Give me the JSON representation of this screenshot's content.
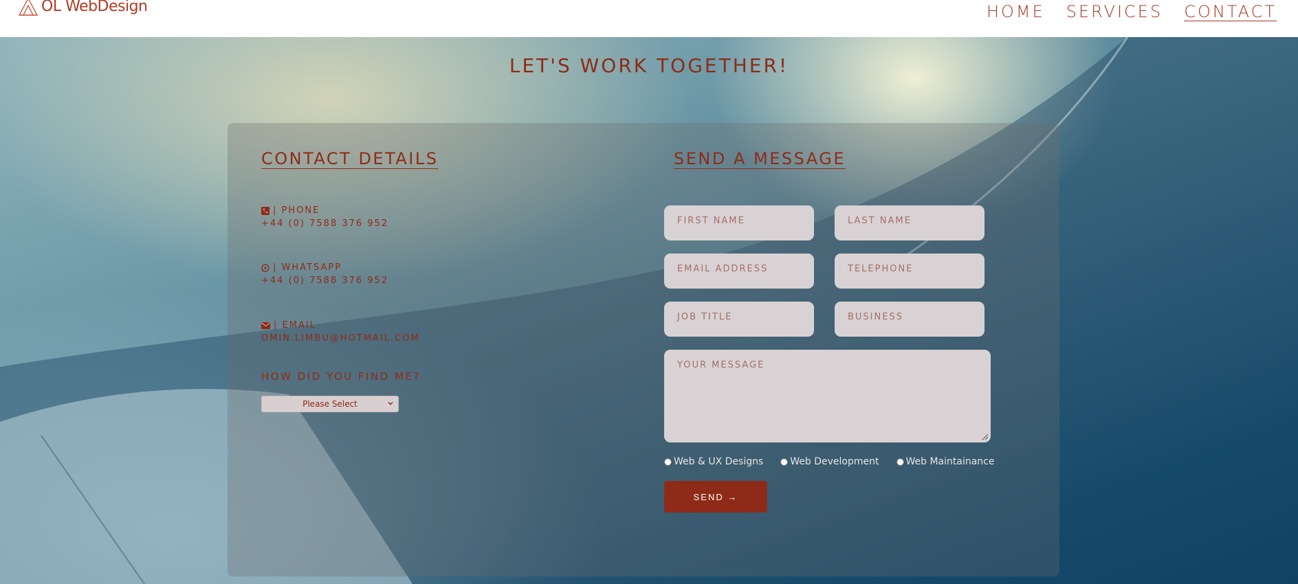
{
  "brand": {
    "name": "OL WebDesign"
  },
  "nav": {
    "items": [
      {
        "label": "HOME"
      },
      {
        "label": "SERVICES"
      },
      {
        "label": "CONTACT",
        "active": true
      }
    ]
  },
  "headline": "LET'S WORK TOGETHER!",
  "contact": {
    "title": "CONTACT DETAILS",
    "phone": {
      "label": "| PHONE",
      "value": "+44 (0) 7588 376 952",
      "icon": "phone-icon"
    },
    "whatsapp": {
      "label": "| WHATSAPP",
      "value": "+44 (0) 7588 376 952",
      "icon": "whatsapp-icon"
    },
    "email": {
      "label": "| EMAIL",
      "value": "OMIN.LIMBU@HOTMAIL.COM",
      "icon": "envelope-icon"
    },
    "find": {
      "title": "HOW DID YOU FIND ME?",
      "selected": "Please Select"
    }
  },
  "form": {
    "title": "SEND A MESSAGE",
    "first_name": "FIRST NAME",
    "last_name": "LAST NAME",
    "email": "EMAIL ADDRESS",
    "telephone": "TELEPHONE",
    "job_title": "JOB TITLE",
    "business": "BUSINESS",
    "message": "YOUR MESSAGE",
    "options": [
      "Web & UX Designs",
      "Web Development",
      "Web Maintainance"
    ],
    "send_label": "SEND →"
  },
  "colors": {
    "accent": "#8e2b18",
    "header_bg": "#ffffff",
    "field_bg": "#d8d2d5"
  }
}
